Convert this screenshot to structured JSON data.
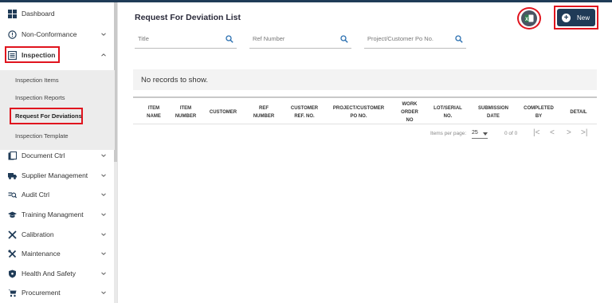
{
  "sidebar": {
    "items": [
      {
        "label": "Dashboard",
        "icon": "dashboard-icon"
      },
      {
        "label": "Non-Conformance",
        "icon": "alert-circle-icon"
      },
      {
        "label": "Inspection",
        "icon": "inspection-icon"
      },
      {
        "label": "Document Ctrl",
        "icon": "document-icon"
      },
      {
        "label": "Supplier Management",
        "icon": "truck-icon"
      },
      {
        "label": "Audit Ctrl",
        "icon": "audit-icon"
      },
      {
        "label": "Training Managment",
        "icon": "graduation-cap-icon"
      },
      {
        "label": "Calibration",
        "icon": "tools-icon"
      },
      {
        "label": "Maintenance",
        "icon": "wrench-icon"
      },
      {
        "label": "Health And Safety",
        "icon": "shield-icon"
      },
      {
        "label": "Procurement",
        "icon": "cart-icon"
      }
    ],
    "subitems": [
      {
        "label": "Inspection Items"
      },
      {
        "label": "Inspection Reports"
      },
      {
        "label": "Request For Deviations"
      },
      {
        "label": "Inspection Template"
      }
    ]
  },
  "main": {
    "title": "Request For Deviation List",
    "new_label": "New",
    "filters": [
      {
        "placeholder": "Title"
      },
      {
        "placeholder": "Ref Number"
      },
      {
        "placeholder": "Project/Customer Po No."
      }
    ],
    "empty_message": "No records to show.",
    "columns": [
      [
        "ITEM",
        "NAME"
      ],
      [
        "ITEM",
        "NUMBER"
      ],
      [
        "CUSTOMER"
      ],
      [
        "REF",
        "NUMBER"
      ],
      [
        "CUSTOMER",
        "REF. NO."
      ],
      [
        "PROJECT/CUSTOMER",
        "PO NO."
      ],
      [
        "WORK",
        "ORDER",
        "NO"
      ],
      [
        "LOT/SERIAL",
        "NO."
      ],
      [
        "SUBMISSION",
        "DATE"
      ],
      [
        "COMPLETED",
        "BY"
      ],
      [
        "DETAIL"
      ]
    ],
    "pager": {
      "items_per_page_label": "Items per page:",
      "page_size": "25",
      "range": "0 of 0"
    }
  },
  "colors": {
    "accent": "#1f3b57",
    "highlight_box": "#e0141e"
  }
}
